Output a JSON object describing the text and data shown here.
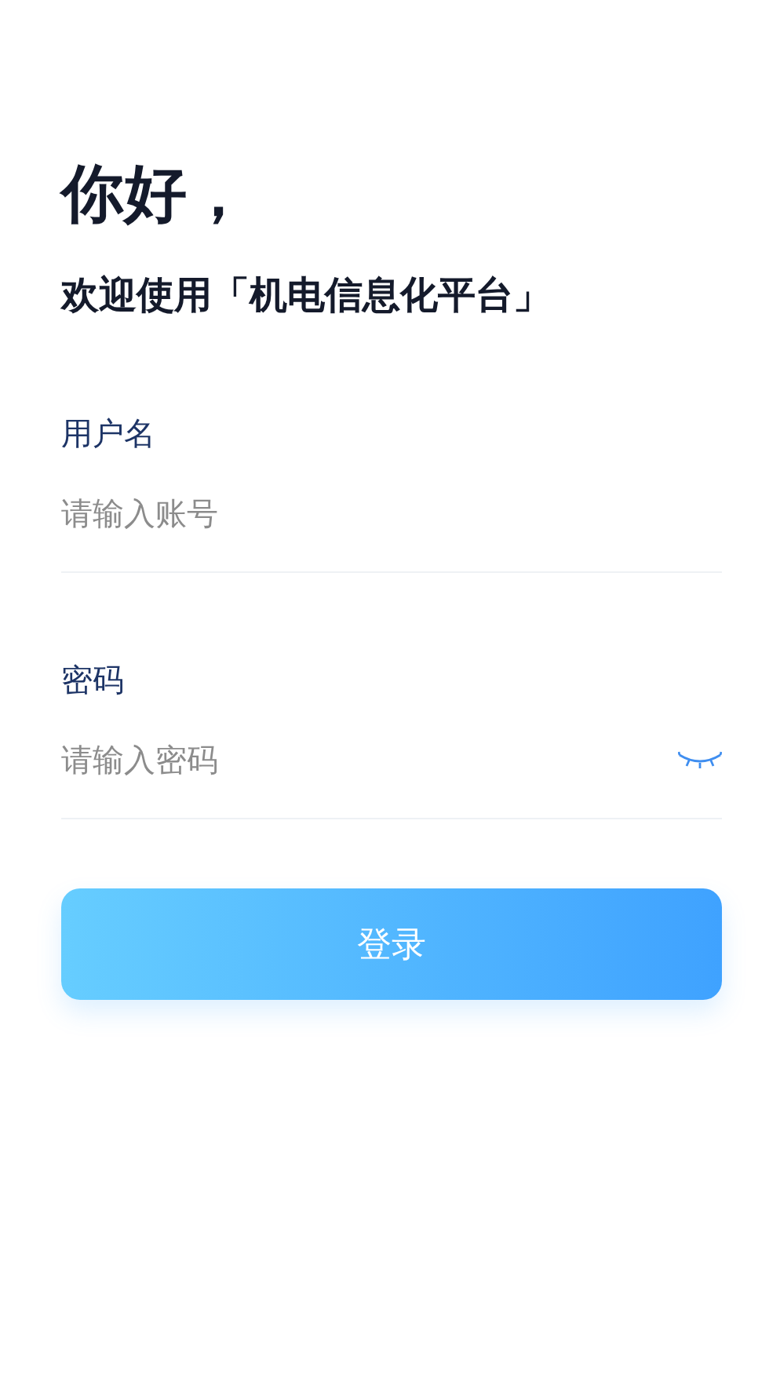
{
  "greeting": "你好，",
  "subtitle": "欢迎使用「机电信息化平台」",
  "fields": [
    {
      "kind": "text",
      "label": "用户名",
      "placeholder": "请输入账号"
    },
    {
      "kind": "password",
      "label": "密码",
      "placeholder": "请输入密码"
    }
  ],
  "login_button": "登录"
}
